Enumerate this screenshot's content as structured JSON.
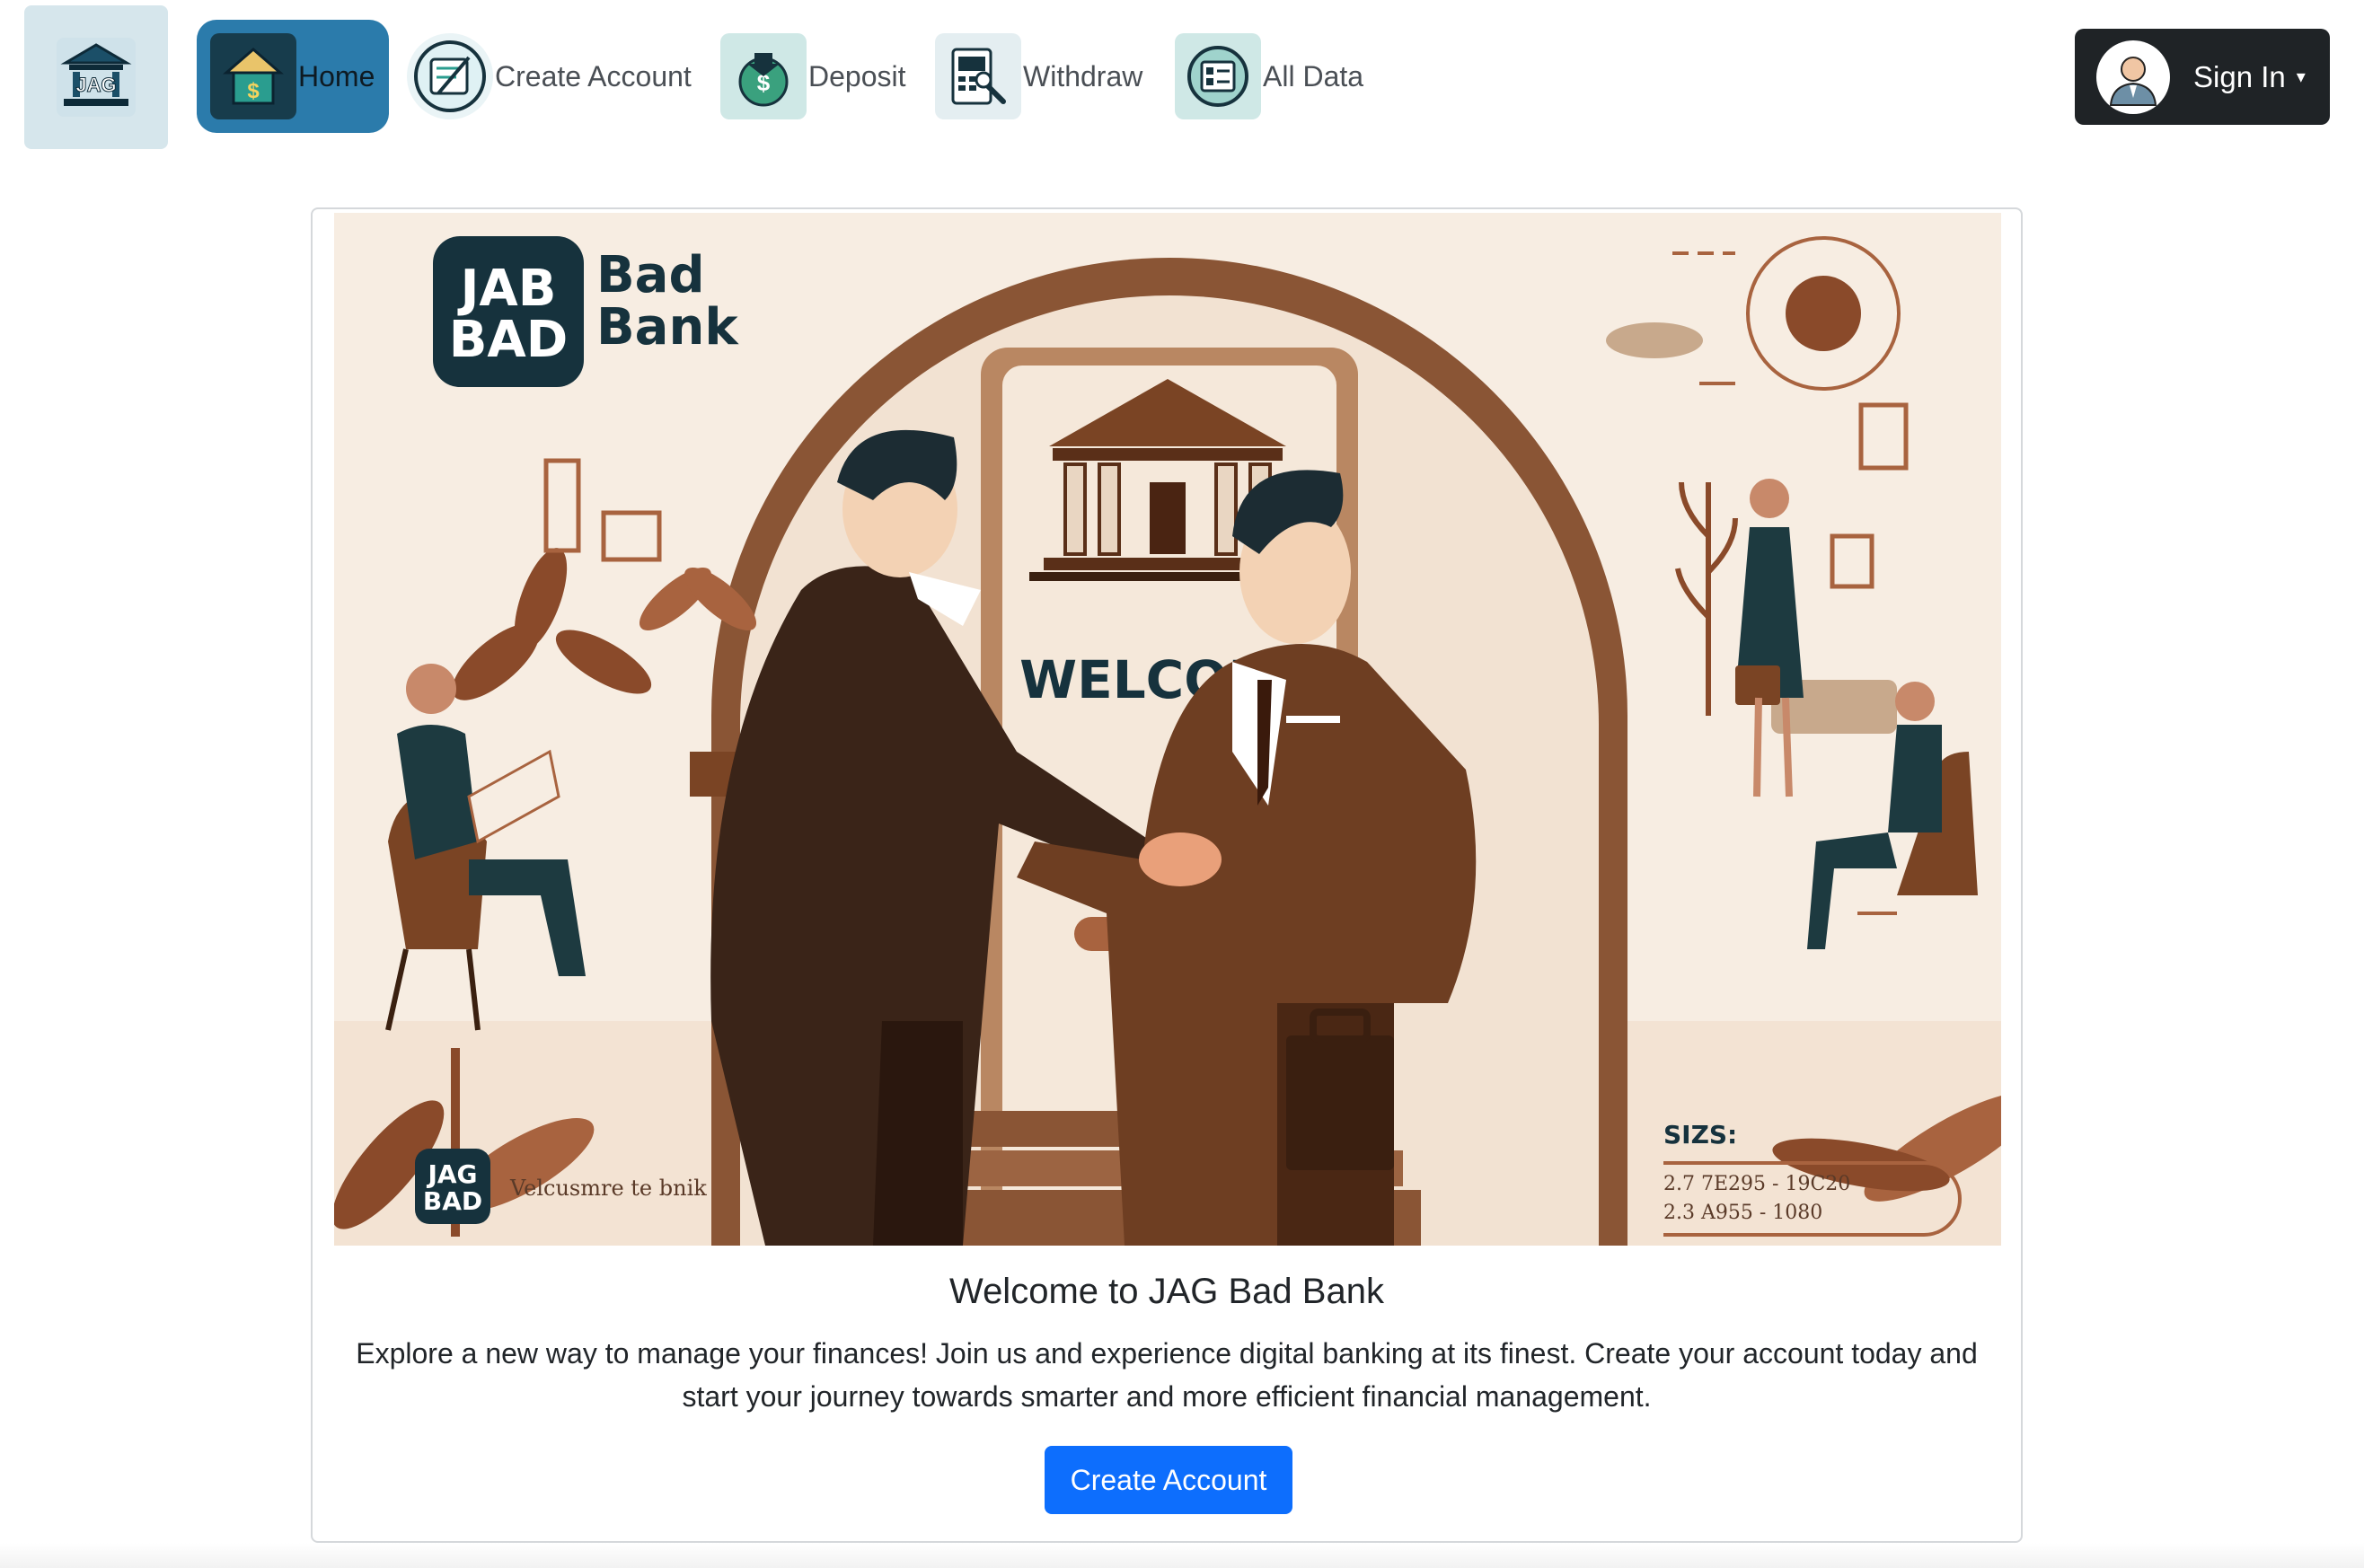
{
  "nav": {
    "brand_logo_text": "JAG",
    "items": [
      {
        "label": "Home",
        "icon": "home-dollar-icon",
        "active": true
      },
      {
        "label": "Create Account",
        "icon": "create-account-icon"
      },
      {
        "label": "Deposit",
        "icon": "deposit-icon"
      },
      {
        "label": "Withdraw",
        "icon": "withdraw-icon"
      },
      {
        "label": "All Data",
        "icon": "all-data-icon"
      }
    ],
    "signin_label": "Sign In",
    "signin_caret": "▾"
  },
  "hero": {
    "logo_line1": "JAB",
    "logo_line2": "BAD",
    "name_line1": "Bad",
    "name_line2": "Bank",
    "welcome_sign": "WELCOME",
    "corner_logo_line1": "JAG",
    "corner_logo_line2": "BAD",
    "corner_tagline": "Velcusmre te bnik",
    "sizes_label": "SIZS:",
    "sizes_line1": "2.7 7E295 - 19C20",
    "sizes_line2": "2.3 A955 - 1080"
  },
  "card": {
    "title": "Welcome to JAG Bad Bank",
    "text": "Explore a new way to manage your finances! Join us and experience digital banking at its finest. Create your account today and start your journey towards smarter and more efficient financial management.",
    "cta_label": "Create Account"
  },
  "colors": {
    "active_nav": "#2b7bab",
    "signin_bg": "#1f2326",
    "primary": "#0d6efd",
    "hero_brown": "#7a4a2e",
    "hero_dark": "#1d3a40"
  }
}
